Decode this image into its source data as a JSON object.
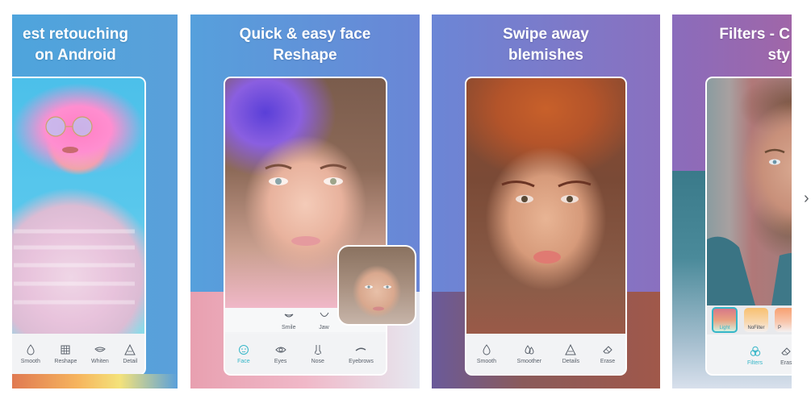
{
  "gallery": {
    "screenshots": [
      {
        "headline_line1": "Best retouching",
        "headline_line1_visible": "est retouching",
        "headline_line2": "on Android",
        "tools": [
          {
            "label": "Smooth",
            "icon": "droplet-icon"
          },
          {
            "label": "Reshape",
            "icon": "grid-icon"
          },
          {
            "label": "Whiten",
            "icon": "lips-icon"
          },
          {
            "label": "Details",
            "icon": "triangle-icon"
          }
        ],
        "tool_label_visible_last": "Detail"
      },
      {
        "headline_line1": "Quick & easy face",
        "headline_line2": "Reshape",
        "sub_tools": [
          {
            "label": "Smile",
            "icon": "smile-icon"
          },
          {
            "label": "Jaw",
            "icon": "jaw-icon"
          }
        ],
        "tools": [
          {
            "label": "Face",
            "icon": "face-icon",
            "active": true
          },
          {
            "label": "Eyes",
            "icon": "eye-icon"
          },
          {
            "label": "Nose",
            "icon": "nose-icon"
          },
          {
            "label": "Eyebrows",
            "icon": "eyebrow-icon"
          }
        ]
      },
      {
        "headline_line1": "Swipe away",
        "headline_line2": "blemishes",
        "tools": [
          {
            "label": "Smooth",
            "icon": "droplet-icon"
          },
          {
            "label": "Smoother",
            "icon": "droplets-icon"
          },
          {
            "label": "Details",
            "icon": "triangle-icon"
          },
          {
            "label": "Erase",
            "icon": "eraser-icon"
          }
        ]
      },
      {
        "headline_line1_visible": "Filters - C",
        "headline_line2_visible": "sty",
        "filters": [
          {
            "label": "Light",
            "selected": true
          },
          {
            "label": "NoFilter"
          },
          {
            "label": "P"
          }
        ],
        "tools": [
          {
            "label": "Filters",
            "icon": "filters-icon",
            "active": true
          },
          {
            "label": "Eras",
            "icon": "eraser-icon"
          }
        ]
      }
    ],
    "next_arrow": "›",
    "colors": {
      "accent": "#35b6c8",
      "tool_text": "#59606a",
      "headline": "#ffffff"
    }
  }
}
